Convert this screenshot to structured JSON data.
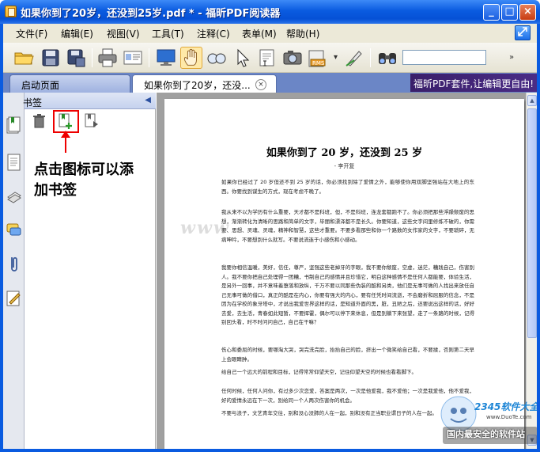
{
  "window": {
    "title": "如果你到了20岁，还没到25岁.pdf * - 福昕PDF阅读器",
    "minimize": "_",
    "maximize": "□",
    "close": "×"
  },
  "menu": {
    "items": [
      "文件(F)",
      "编辑(E)",
      "视图(V)",
      "工具(T)",
      "注释(C)",
      "表单(M)",
      "帮助(H)"
    ]
  },
  "toolbar": {
    "search_value": "",
    "more": "»"
  },
  "tabs": {
    "start": "启动页面",
    "document": "如果你到了20岁，还没...",
    "close": "×",
    "banner": "福昕PDF套件,让编辑更自由!"
  },
  "bookmark": {
    "title": "书签",
    "collapse": "◀",
    "annotation": "点击图标可以添加书签"
  },
  "document": {
    "title": "如果你到了 20 岁，还没到 25 岁",
    "author": "- 李开复",
    "paragraphs": [
      "如果你已经过了 20 岁但还不到 25 岁的话，你必须找到除了爱情之外，能够使你用双脚坚强站在大地上的东西。你要找到谋生的方式，现在考虑不晚了。",
      "我从来不以为学历有什么重要，天才都不是科班，但，不是科班，连龙套都跑不了。你必须把那些浮躁颓废的思想，渐渐转化为清晰的思路和简单的文字，毕丽和漂泽都不是长久。你要知道，这些文字间里修炼不破的，你需要、思想、灵魂、灵魂，精神和智慧，这些才重要。不要多看那些和你一个路数的女作家的文字，不要琐碎，无病呻吟，不要想到什么就写。不要说流连于小感伤和小感动。",
      "我要你相信温暖，美好，信任，尊严，坚强这些老掉牙的字眼，我不要你颓废，空虚，迷茫，糟践自己，伤害别人。我不要你把自己处理得一团糟，书制自己的感情并且珍惜它，明白这种感情不是任何人都能要，体验生活，是另外一回事，并不意味着堕落和放纵，千万不要以同那些伪装的酷和另类，他们是无事可做的人找出来放任自己无事可做的借口，真正的酷是在内心，你要有强大的内心，要有任凭时间流逝，不会磨折和屈服的信念，不是因为在学校的象牙塔中，才说出我爱世界这样的话，是知道外面的黑，脏，丑陋之后，还要说出这样的话，好好去爱，去生活，青春如此短暂，不要挥霍，偶尔可以停下来休息，但是别躺下来张望，走了一条路的时候，记得别回头看，时不时问问自己，自己在干嘛？",
      "伤心和委屈的时候，要哪淘大哭，哭完洗完脸，抬抬自己的脸，挤出一个微笑给自己看，不要揉，否则第二天早上会眼睛肿。",
      "给自己一个远大的前程和目标，记得常常仰望天空，记住仰望天空的时候也看看脚下。",
      "任何时候，任何人问你，有过多少次恋爱，答案是两次，一次是他爱我，我不爱他；一次是我爱他，他不爱我，好的爱情永远在下一次，别给同一个人两次伤害你的机会。",
      "不要与浪子，文艺青年交往，别和没心没肺的人在一起，别和没有正当职业谓日子的人在一起。"
    ],
    "watermark": "www"
  },
  "corner_logo": {
    "brand": "2345软件大全",
    "url": "www.DuoTe.com",
    "slogan": "国内最安全的软件站"
  }
}
